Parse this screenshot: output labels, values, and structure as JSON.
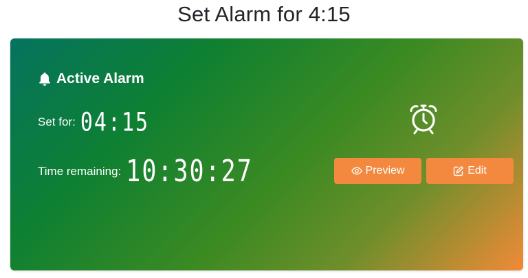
{
  "page": {
    "title": "Set Alarm for 4:15"
  },
  "card": {
    "header_icon": "bell-icon",
    "header_label": "Active Alarm",
    "set_for_label": "Set for:",
    "set_for_value": "04:15",
    "remaining_label": "Time remaining:",
    "remaining_value": "10:30:27",
    "clock_icon": "alarm-clock-icon",
    "preview_button": {
      "icon": "eye-icon",
      "label": "Preview"
    },
    "edit_button": {
      "icon": "edit-icon",
      "label": "Edit"
    }
  },
  "colors": {
    "title": "#212529",
    "gradient_start": "#05735f",
    "gradient_mid": "#3b8a22",
    "gradient_end": "#f18a37",
    "button": "#f3893f",
    "text_on_card": "#ffffff"
  }
}
